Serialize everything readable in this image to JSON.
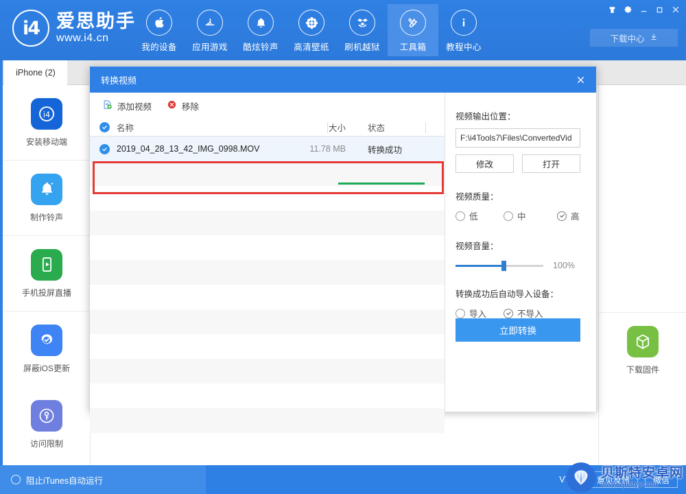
{
  "app": {
    "brand_cn": "爱思助手",
    "brand_url": "www.i4.cn",
    "logo_mark": "i4",
    "accent": "#2f80e4",
    "version": "V7.93"
  },
  "nav": {
    "items": [
      {
        "label": "我的设备",
        "icon": "apple-icon",
        "active": false
      },
      {
        "label": "应用游戏",
        "icon": "appstore-icon",
        "active": false
      },
      {
        "label": "酷炫铃声",
        "icon": "bell-icon",
        "active": false
      },
      {
        "label": "高清壁纸",
        "icon": "flower-icon",
        "active": false
      },
      {
        "label": "刷机越狱",
        "icon": "box-open-icon",
        "active": false
      },
      {
        "label": "工具箱",
        "icon": "tools-icon",
        "active": true
      },
      {
        "label": "教程中心",
        "icon": "info-icon",
        "active": false
      }
    ]
  },
  "window_controls": [
    {
      "name": "skin-icon",
      "glyph": "skin"
    },
    {
      "name": "gear-icon",
      "glyph": "gear"
    },
    {
      "name": "minimize-icon",
      "glyph": "minimize"
    },
    {
      "name": "maximize-icon",
      "glyph": "maximize"
    },
    {
      "name": "close-icon",
      "glyph": "close"
    }
  ],
  "download_center": {
    "label": "下载中心",
    "icon": "download-icon"
  },
  "tab": {
    "label": "iPhone (2)"
  },
  "sidebar": {
    "items": [
      {
        "label": "安装移动端",
        "icon": "i4-app-icon",
        "color": "#1565d8"
      },
      {
        "label": "制作铃声",
        "icon": "bell-app-icon",
        "color": "#36a3f0"
      },
      {
        "label": "手机投屏直播",
        "icon": "screen-cast-icon",
        "color": "#2aab4d"
      },
      {
        "label": "屏蔽iOS更新",
        "icon": "gear-block-icon",
        "color": "#3e84f5"
      },
      {
        "label": "访问限制",
        "icon": "key-lock-icon",
        "color": "#6f7fe0"
      }
    ]
  },
  "rightrail": {
    "items": [
      {
        "label": "下载固件",
        "icon": "cube-icon",
        "color": "#78c043"
      }
    ]
  },
  "dialog": {
    "title": "转换视频",
    "close_icon": "close-icon",
    "toolbar": {
      "add_label": "添加视频",
      "add_icon": "add-video-icon",
      "remove_label": "移除",
      "remove_icon": "remove-circle-icon"
    },
    "list": {
      "headers": {
        "name": "名称",
        "size": "大小",
        "state": "状态"
      },
      "select_all_checked": true,
      "rows": [
        {
          "checked": true,
          "name": "2019_04_28_13_42_IMG_0998.MOV",
          "size": "11.78 MB",
          "state": "转换成功",
          "progress": 100,
          "selected": true
        }
      ],
      "empty_row_count": 11
    },
    "output": {
      "label": "视频输出位置：",
      "path_value": "F:\\i4Tools7\\Files\\ConvertedVid",
      "modify_label": "修改",
      "open_label": "打开"
    },
    "quality": {
      "label": "视频质量：",
      "options": [
        {
          "label": "低",
          "checked": false
        },
        {
          "label": "中",
          "checked": false
        },
        {
          "label": "高",
          "checked": true
        }
      ]
    },
    "volume": {
      "label": "视频音量：",
      "value_text": "100%",
      "thumb_position_pct": 55
    },
    "auto_import": {
      "label": "转换成功后自动导入设备：",
      "options": [
        {
          "label": "导入",
          "checked": false
        },
        {
          "label": "不导入",
          "checked": true
        }
      ]
    },
    "convert_button": "立即转换"
  },
  "statusbar": {
    "itunes_label": "阻止iTunes自动运行",
    "version": "V7.93",
    "feedback_label": "意见反馈",
    "wechat_label": "微信"
  },
  "watermark": {
    "title": "贝斯特安卓网",
    "url": "www.zjbstyy.com"
  }
}
